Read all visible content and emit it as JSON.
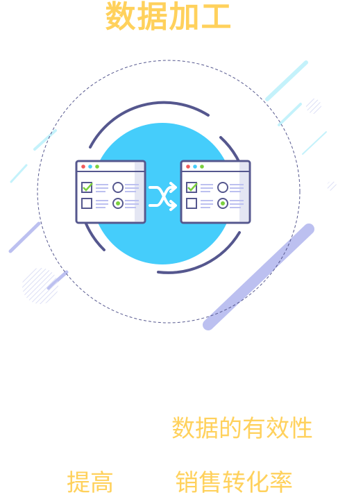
{
  "title": "数据加工",
  "captions": {
    "line1": "数据的有效性",
    "line2_left": "提高",
    "line2_right": "销售转化率"
  },
  "colors": {
    "title": "#ffd15c",
    "caption": "#ffd15c",
    "circle_fill": "#45cdfb",
    "stroke": "#55578e",
    "accent_lavender": "#bcc0f0",
    "accent_cyan": "#c4f2fb",
    "check_green": "#7bd03f"
  },
  "icons": {
    "left_window": "checklist-window-icon",
    "shuffle": "shuffle-arrows-icon",
    "right_window": "checklist-window-icon"
  }
}
